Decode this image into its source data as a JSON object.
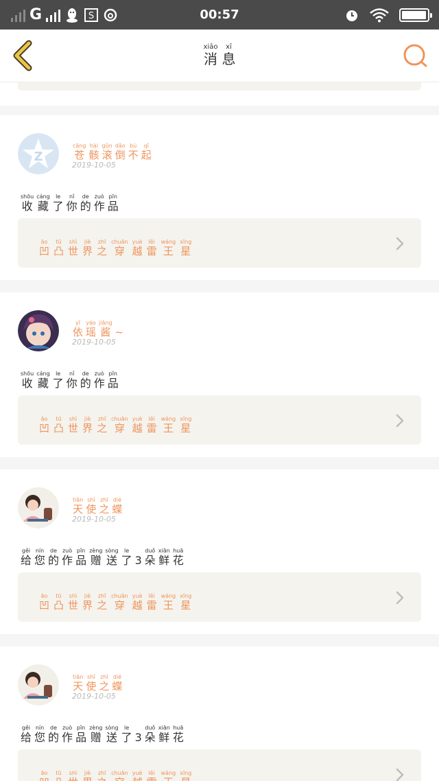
{
  "status_bar": {
    "network": "G",
    "time": "00:57",
    "icons": [
      "signal-icon",
      "qq-icon",
      "s-app-icon",
      "netease-music-icon",
      "alarm-icon",
      "wifi-icon",
      "battery-icon"
    ]
  },
  "header": {
    "title": [
      {
        "p": "xiāo",
        "h": "消"
      },
      {
        "p": "xī",
        "h": "息"
      }
    ],
    "back_icon": "chevron-left-icon",
    "search_icon": "search-icon"
  },
  "work_title": [
    {
      "p": "āo",
      "h": "凹"
    },
    {
      "p": "tū",
      "h": "凸"
    },
    {
      "p": "shì",
      "h": "世"
    },
    {
      "p": "jiè",
      "h": "界"
    },
    {
      "p": "zhī",
      "h": "之"
    },
    {
      "p": "chuān",
      "h": "穿"
    },
    {
      "p": "yuè",
      "h": "越"
    },
    {
      "p": "lěi",
      "h": "雷"
    },
    {
      "p": "wáng",
      "h": "王"
    },
    {
      "p": "xīng",
      "h": "星"
    }
  ],
  "messages": [
    {
      "avatar": "qq-default-avatar",
      "user_name": [
        {
          "p": "cāng",
          "h": "苍"
        },
        {
          "p": "hài",
          "h": "骸"
        },
        {
          "p": "gǔn",
          "h": "滚"
        },
        {
          "p": "dǎo",
          "h": "倒"
        },
        {
          "p": "bù",
          "h": "不"
        },
        {
          "p": "qǐ",
          "h": "起"
        }
      ],
      "date": "2019-10-05",
      "message": [
        {
          "p": "shōu",
          "h": "收"
        },
        {
          "p": "cáng",
          "h": "藏"
        },
        {
          "p": "le",
          "h": "了"
        },
        {
          "p": "nǐ",
          "h": "你"
        },
        {
          "p": "de",
          "h": "的"
        },
        {
          "p": "zuò",
          "h": "作"
        },
        {
          "p": "pǐn",
          "h": "品"
        }
      ]
    },
    {
      "avatar": "anime-girl-avatar",
      "user_name": [
        {
          "p": "yī",
          "h": "依"
        },
        {
          "p": "yáo",
          "h": "瑶"
        },
        {
          "p": "jiāng",
          "h": "酱"
        },
        {
          "p": "",
          "h": "~"
        }
      ],
      "date": "2019-10-05",
      "message": [
        {
          "p": "shōu",
          "h": "收"
        },
        {
          "p": "cáng",
          "h": "藏"
        },
        {
          "p": "le",
          "h": "了"
        },
        {
          "p": "nǐ",
          "h": "你"
        },
        {
          "p": "de",
          "h": "的"
        },
        {
          "p": "zuò",
          "h": "作"
        },
        {
          "p": "pǐn",
          "h": "品"
        }
      ]
    },
    {
      "avatar": "child-photo-avatar",
      "user_name": [
        {
          "p": "tiān",
          "h": "天"
        },
        {
          "p": "shǐ",
          "h": "使"
        },
        {
          "p": "zhī",
          "h": "之"
        },
        {
          "p": "dié",
          "h": "蝶"
        }
      ],
      "date": "2019-10-05",
      "message": [
        {
          "p": "gěi",
          "h": "给"
        },
        {
          "p": "nín",
          "h": "您"
        },
        {
          "p": "de",
          "h": "的"
        },
        {
          "p": "zuò",
          "h": "作"
        },
        {
          "p": "pǐn",
          "h": "品"
        },
        {
          "p": "zèng",
          "h": "赠"
        },
        {
          "p": "sòng",
          "h": "送"
        },
        {
          "p": "le",
          "h": "了"
        },
        {
          "p": "",
          "h": "3"
        },
        {
          "p": "duǒ",
          "h": "朵"
        },
        {
          "p": "xiān",
          "h": "鲜"
        },
        {
          "p": "huā",
          "h": "花"
        }
      ]
    },
    {
      "avatar": "child-photo-avatar",
      "user_name": [
        {
          "p": "tiān",
          "h": "天"
        },
        {
          "p": "shǐ",
          "h": "使"
        },
        {
          "p": "zhī",
          "h": "之"
        },
        {
          "p": "dié",
          "h": "蝶"
        }
      ],
      "date": "2019-10-05",
      "message": [
        {
          "p": "gěi",
          "h": "给"
        },
        {
          "p": "nín",
          "h": "您"
        },
        {
          "p": "de",
          "h": "的"
        },
        {
          "p": "zuò",
          "h": "作"
        },
        {
          "p": "pǐn",
          "h": "品"
        },
        {
          "p": "zèng",
          "h": "赠"
        },
        {
          "p": "sòng",
          "h": "送"
        },
        {
          "p": "le",
          "h": "了"
        },
        {
          "p": "",
          "h": "3"
        },
        {
          "p": "duǒ",
          "h": "朵"
        },
        {
          "p": "xiān",
          "h": "鲜"
        },
        {
          "p": "huā",
          "h": "花"
        }
      ]
    }
  ],
  "colors": {
    "status_bar": "#4a4a4a",
    "accent_orange": "#f0935a",
    "back_arrow": "#e9c64a",
    "card_bg": "#ffffff",
    "separator": "#f5f5f5",
    "work_box": "#f4f3ee"
  }
}
